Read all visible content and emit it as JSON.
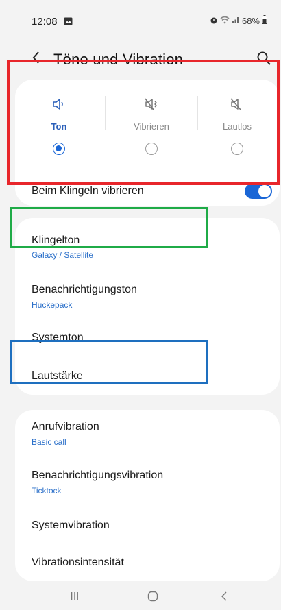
{
  "status_bar": {
    "time": "12:08",
    "battery": "68%"
  },
  "header": {
    "title": "Töne und Vibration"
  },
  "sound_mode": {
    "options": [
      {
        "label": "Ton",
        "selected": true
      },
      {
        "label": "Vibrieren",
        "selected": false
      },
      {
        "label": "Lautlos",
        "selected": false
      }
    ]
  },
  "ring_vibrate": {
    "label": "Beim Klingeln vibrieren",
    "enabled": true
  },
  "sound_settings": {
    "ringtone": {
      "title": "Klingelton",
      "value": "Galaxy / Satellite"
    },
    "notification_sound": {
      "title": "Benachrichtigungston",
      "value": "Huckepack"
    },
    "system_sound": {
      "title": "Systemton"
    },
    "volume": {
      "title": "Lautstärke"
    }
  },
  "vibration_settings": {
    "call_vibration": {
      "title": "Anrufvibration",
      "value": "Basic call"
    },
    "notification_vibration": {
      "title": "Benachrichtigungsvibration",
      "value": "Ticktock"
    },
    "system_vibration": {
      "title": "Systemvibration"
    },
    "vibration_intensity": {
      "title": "Vibrationsintensität"
    }
  },
  "colors": {
    "accent": "#1a66d6",
    "subtitle": "#2a6fc9",
    "highlight_red": "#e8262b",
    "highlight_green": "#1fab47",
    "highlight_blue": "#1e6fbf"
  }
}
